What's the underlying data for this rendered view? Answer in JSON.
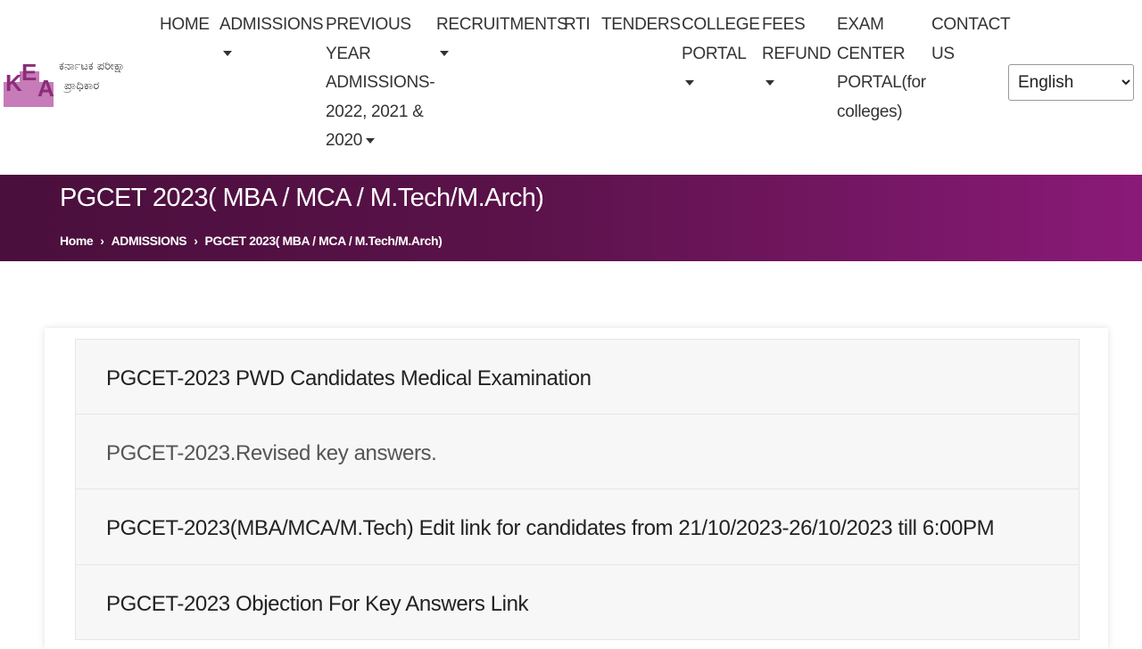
{
  "logo": {
    "letters": "KEA",
    "text_line1": "ಕರ್ನಾಟಕ ಪರೀಕ್ಷಾ",
    "text_line2": "ಪ್ರಾಧಿಕಾರ",
    "color": "#b04a9c"
  },
  "nav": {
    "home": "HOME",
    "admissions": "ADMISSIONS",
    "previous_1": "PREVIOUS",
    "previous_2": "YEAR",
    "previous_3": "ADMISSIONS-",
    "previous_4": "2022, 2021 &",
    "previous_5": "2020",
    "recruitments": "RECRUITMENTS",
    "rti": "RTI",
    "tenders": "TENDERS",
    "college_1": "COLLEGE",
    "college_2": "PORTAL",
    "fees_1": "FEES",
    "fees_2": "REFUND",
    "exam_1": "EXAM",
    "exam_2": "CENTER",
    "exam_3": "PORTAL(for",
    "exam_4": "colleges)",
    "contact_1": "CONTACT",
    "contact_2": "US"
  },
  "language": {
    "selected": "English"
  },
  "banner": {
    "title": "PGCET 2023( MBA / MCA / M.Tech/M.Arch)",
    "breadcrumb": [
      "Home",
      "ADMISSIONS",
      "PGCET 2023( MBA / MCA / M.Tech/M.Arch)"
    ],
    "gradient_colors": [
      "#4a0f3c",
      "#8a1a78"
    ]
  },
  "items": [
    "PGCET-2023 PWD Candidates Medical Examination",
    "PGCET-2023.Revised key answers.",
    "PGCET-2023(MBA/MCA/M.Tech) Edit link for candidates from 21/10/2023-26/10/2023 till 6:00PM",
    "PGCET-2023 Objection For Key Answers Link"
  ]
}
